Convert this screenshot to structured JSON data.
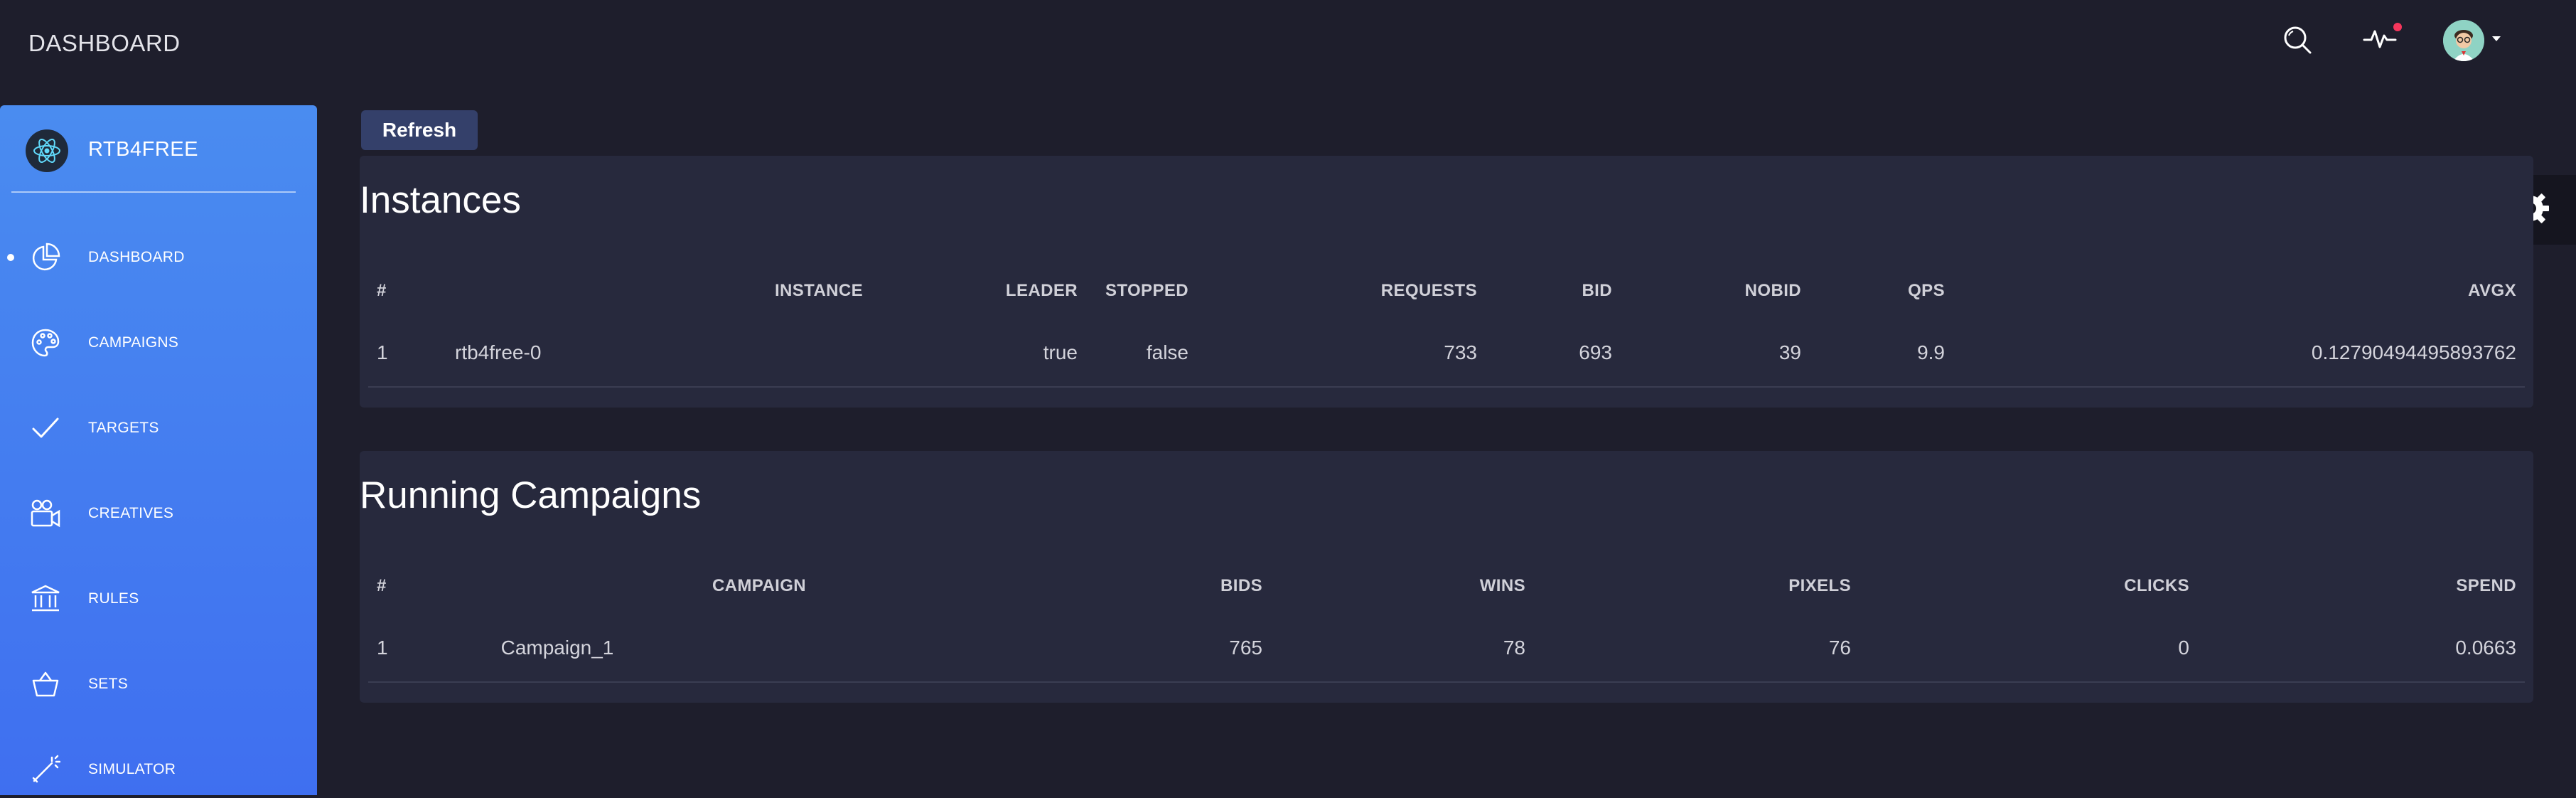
{
  "header": {
    "title": "DASHBOARD",
    "icons": [
      "search-icon",
      "activity-icon",
      "avatar",
      "caret-down-icon"
    ]
  },
  "sidebar": {
    "brand": "RTB4FREE",
    "items": [
      {
        "label": "DASHBOARD",
        "icon": "pie-chart-icon",
        "active": true
      },
      {
        "label": "CAMPAIGNS",
        "icon": "palette-icon",
        "active": false
      },
      {
        "label": "TARGETS",
        "icon": "check-icon",
        "active": false
      },
      {
        "label": "CREATIVES",
        "icon": "video-camera-icon",
        "active": false
      },
      {
        "label": "RULES",
        "icon": "bank-icon",
        "active": false
      },
      {
        "label": "SETS",
        "icon": "basket-icon",
        "active": false
      },
      {
        "label": "SIMULATOR",
        "icon": "wand-icon",
        "active": false
      }
    ]
  },
  "toolbar": {
    "refresh_label": "Refresh"
  },
  "instances": {
    "title": "Instances",
    "columns": [
      "#",
      "INSTANCE",
      "LEADER",
      "STOPPED",
      "REQUESTS",
      "BID",
      "NOBID",
      "QPS",
      "AVGX"
    ],
    "rows": [
      [
        "1",
        "rtb4free-0",
        "true",
        "false",
        "733",
        "693",
        "39",
        "9.9",
        "0.12790494495893762"
      ]
    ]
  },
  "campaigns": {
    "title": "Running Campaigns",
    "columns": [
      "#",
      "CAMPAIGN",
      "BIDS",
      "WINS",
      "PIXELS",
      "CLICKS",
      "SPEND"
    ],
    "rows": [
      [
        "1",
        "Campaign_1",
        "765",
        "78",
        "76",
        "0",
        "0.0663"
      ]
    ]
  },
  "colors": {
    "background": "#1e1e2c",
    "card": "#27293d",
    "sidebar_top": "#4a8cf0",
    "sidebar_bottom": "#3f6ff0",
    "button": "#34406a",
    "notification": "#f5365c"
  }
}
